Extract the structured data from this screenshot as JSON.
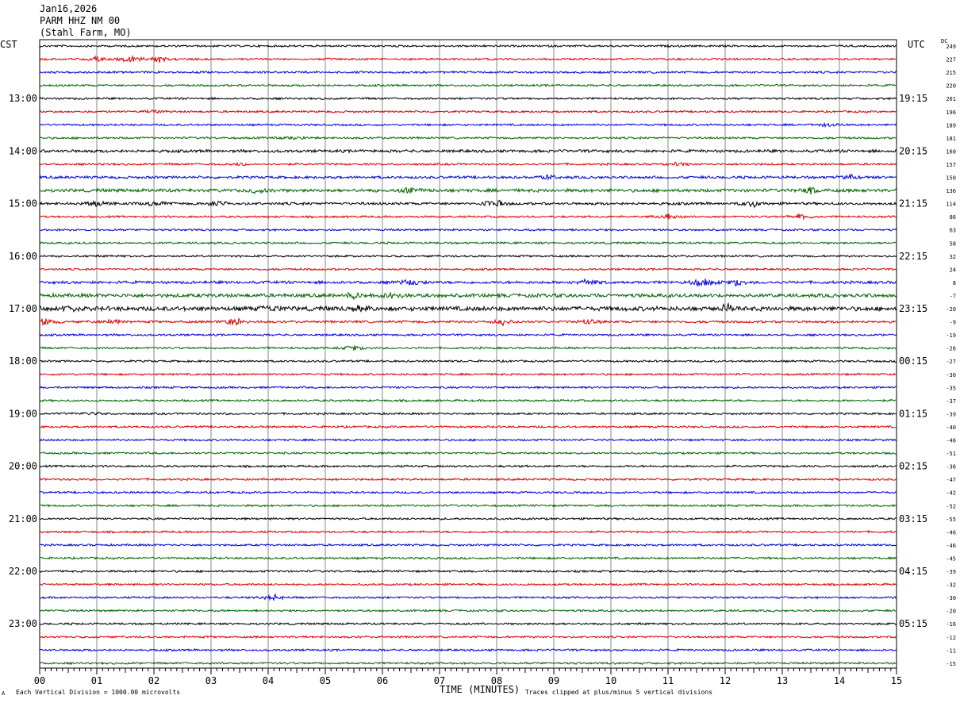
{
  "header": {
    "date": "Jan16,2026",
    "station": "PARM HHZ NM 00",
    "location": "(Stahl Farm, MO)"
  },
  "footer": {
    "scale_note": "Each Vertical Division = 1000.00 microvolts",
    "clip_note": "Traces clipped at plus/minus 5 vertical divisions",
    "corner_mark": "A"
  },
  "chart_data": {
    "type": "line",
    "title": "",
    "xlabel": "TIME (MINUTES)",
    "left_axis_label": "CST",
    "right_axis_label": "UTC",
    "dc_label": "DC",
    "xlim": [
      0,
      15
    ],
    "x_ticks": [
      "00",
      "01",
      "02",
      "03",
      "04",
      "05",
      "06",
      "07",
      "08",
      "09",
      "10",
      "11",
      "12",
      "13",
      "14",
      "15"
    ],
    "grid": "vertical lines at each minute",
    "trace_colors": [
      "#000000",
      "#dd0000",
      "#0000dd",
      "#006600"
    ],
    "row_minutes": 15,
    "left_hour_labels": [
      "13:00",
      "14:00",
      "15:00",
      "16:00",
      "17:00",
      "18:00",
      "19:00",
      "20:00",
      "21:00",
      "22:00",
      "23:00"
    ],
    "right_hour_labels": [
      "19:15",
      "20:15",
      "21:15",
      "22:15",
      "23:15",
      "00:15",
      "01:15",
      "02:15",
      "03:15",
      "04:15",
      "05:15"
    ],
    "hour_label_rows": [
      4,
      8,
      12,
      16,
      20,
      24,
      28,
      32,
      36,
      40,
      44
    ],
    "dc_offsets": [
      249,
      227,
      215,
      220,
      201,
      196,
      189,
      181,
      160,
      157,
      150,
      136,
      114,
      86,
      63,
      58,
      32,
      24,
      8,
      -7,
      -20,
      -9,
      -19,
      -26,
      -27,
      -30,
      -35,
      -37,
      -39,
      -40,
      -46,
      -51,
      -36,
      -47,
      -42,
      -52,
      -55,
      -46,
      -46,
      -45,
      -39,
      -32,
      -30,
      -20,
      -16,
      -12,
      -11,
      -15
    ],
    "events": [
      {
        "row": 1,
        "minute": 1.6,
        "amp": 5
      },
      {
        "row": 1,
        "minute": 2.1,
        "amp": 3
      },
      {
        "row": 1,
        "minute": 1.0,
        "amp": 2
      },
      {
        "row": 5,
        "minute": 2.0,
        "amp": 1.5
      },
      {
        "row": 6,
        "minute": 13.8,
        "amp": 2.5
      },
      {
        "row": 7,
        "minute": 4.5,
        "amp": 2
      },
      {
        "row": 9,
        "minute": 3.5,
        "amp": 1.5
      },
      {
        "row": 9,
        "minute": 11.2,
        "amp": 2
      },
      {
        "row": 10,
        "minute": 8.9,
        "amp": 2.5
      },
      {
        "row": 10,
        "minute": 14.2,
        "amp": 2
      },
      {
        "row": 11,
        "minute": 3.8,
        "amp": 3
      },
      {
        "row": 11,
        "minute": 6.5,
        "amp": 3
      },
      {
        "row": 11,
        "minute": 13.5,
        "amp": 3
      },
      {
        "row": 12,
        "minute": 1.0,
        "amp": 3
      },
      {
        "row": 12,
        "minute": 2.0,
        "amp": 3
      },
      {
        "row": 12,
        "minute": 3.1,
        "amp": 3
      },
      {
        "row": 12,
        "minute": 7.95,
        "amp": 5
      },
      {
        "row": 12,
        "minute": 12.5,
        "amp": 3
      },
      {
        "row": 13,
        "minute": 11.0,
        "amp": 3.5
      },
      {
        "row": 13,
        "minute": 13.3,
        "amp": 3
      },
      {
        "row": 18,
        "minute": 6.5,
        "amp": 3
      },
      {
        "row": 18,
        "minute": 9.6,
        "amp": 3.5
      },
      {
        "row": 18,
        "minute": 11.6,
        "amp": 4.5
      },
      {
        "row": 18,
        "minute": 12.2,
        "amp": 3.5
      },
      {
        "row": 19,
        "minute": 5.5,
        "amp": 3
      },
      {
        "row": 19,
        "minute": 6.2,
        "amp": 4
      },
      {
        "row": 20,
        "minute": 0.5,
        "amp": 3
      },
      {
        "row": 20,
        "minute": 4.0,
        "amp": 3
      },
      {
        "row": 20,
        "minute": 5.6,
        "amp": 3
      },
      {
        "row": 20,
        "minute": 12.05,
        "amp": 4
      },
      {
        "row": 21,
        "minute": 0.1,
        "amp": 4
      },
      {
        "row": 21,
        "minute": 3.4,
        "amp": 4.5
      },
      {
        "row": 21,
        "minute": 1.3,
        "amp": 2.5
      },
      {
        "row": 21,
        "minute": 8.1,
        "amp": 3
      },
      {
        "row": 21,
        "minute": 9.6,
        "amp": 3
      },
      {
        "row": 23,
        "minute": 5.5,
        "amp": 3
      },
      {
        "row": 28,
        "minute": 0.9,
        "amp": 2
      },
      {
        "row": 42,
        "minute": 4.1,
        "amp": 3
      }
    ],
    "noisy_rows": {
      "8": 1.4,
      "10": 1.3,
      "11": 1.6,
      "12": 1.3,
      "18": 1.4,
      "19": 1.8,
      "20": 2.2,
      "21": 1.2
    }
  }
}
